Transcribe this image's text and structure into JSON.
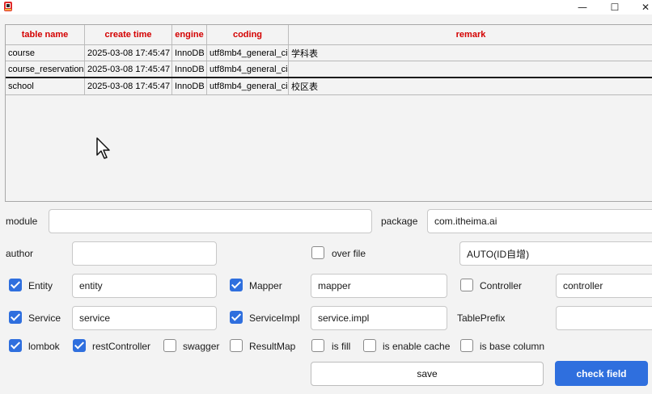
{
  "window": {
    "minimize_glyph": "—",
    "maximize_glyph": "☐",
    "close_glyph": "✕"
  },
  "table": {
    "headers": [
      "table name",
      "create time",
      "engine",
      "coding",
      "remark"
    ],
    "header_color": "#d40000",
    "rows": [
      [
        "course",
        "2025-03-08 17:45:47",
        "InnoDB",
        "utf8mb4_general_ci",
        "学科表"
      ],
      [
        "course_reservation",
        "2025-03-08 17:45:47",
        "InnoDB",
        "utf8mb4_general_ci",
        ""
      ],
      [
        "school",
        "2025-03-08 17:45:47",
        "InnoDB",
        "utf8mb4_general_ci",
        "校区表"
      ]
    ]
  },
  "form": {
    "module_label": "module",
    "module_value": "",
    "package_label": "package",
    "package_value": "com.itheima.ai",
    "author_label": "author",
    "author_value": "",
    "over_file_label": "over file",
    "over_file_checked": false,
    "id_type_value": "AUTO(ID自增)",
    "entity_label": "Entity",
    "entity_checked": true,
    "entity_value": "entity",
    "mapper_label": "Mapper",
    "mapper_checked": true,
    "mapper_value": "mapper",
    "controller_label": "Controller",
    "controller_checked": false,
    "controller_value": "controller",
    "service_label": "Service",
    "service_checked": true,
    "service_value": "service",
    "serviceimpl_label": "ServiceImpl",
    "serviceimpl_checked": true,
    "serviceimpl_value": "service.impl",
    "tableprefix_label": "TablePrefix",
    "tableprefix_value": "",
    "lombok_label": "lombok",
    "lombok_checked": true,
    "restcontroller_label": "restController",
    "restcontroller_checked": true,
    "swagger_label": "swagger",
    "swagger_checked": false,
    "resultmap_label": "ResultMap",
    "resultmap_checked": false,
    "isfill_label": "is fill",
    "isfill_checked": false,
    "enablecache_label": "is enable cache",
    "enablecache_checked": false,
    "basecolumn_label": "is base column",
    "basecolumn_checked": false
  },
  "buttons": {
    "save_label": "save",
    "check_field_label": "check field"
  },
  "colors": {
    "accent": "#2f6fde"
  }
}
